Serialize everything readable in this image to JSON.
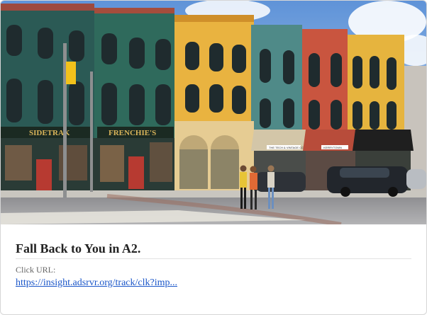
{
  "ad": {
    "title": "Fall Back to You in A2.",
    "click_url_label": "Click URL:",
    "click_url_text": "https://insight.adsrvr.org/track/clk?imp..."
  },
  "photo": {
    "sign_left": "SIDETRAK",
    "sign_right": "FRENCHIE'S",
    "awning_sign_1": "THE TECH & VINTAGE COMPANY",
    "awning_sign_2": "KERRYTOWN"
  }
}
